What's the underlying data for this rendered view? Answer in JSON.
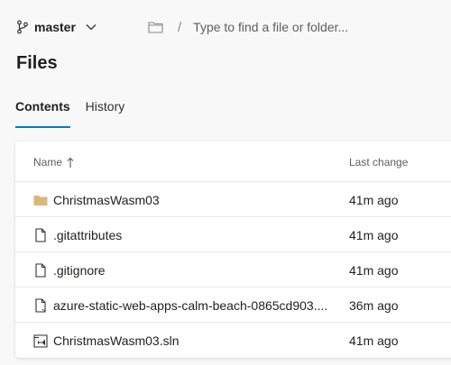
{
  "branch": {
    "name": "master",
    "icon": "branch-icon"
  },
  "path": {
    "separator": "/",
    "placeholder": "Type to find a file or folder..."
  },
  "page_title": "Files",
  "tabs": [
    {
      "label": "Contents",
      "active": true
    },
    {
      "label": "History",
      "active": false
    }
  ],
  "table": {
    "headers": {
      "name": "Name",
      "last_change": "Last change"
    },
    "rows": [
      {
        "icon": "folder-icon",
        "name": "ChristmasWasm03",
        "last_change": "41m ago"
      },
      {
        "icon": "file-icon",
        "name": ".gitattributes",
        "last_change": "41m ago"
      },
      {
        "icon": "file-icon",
        "name": ".gitignore",
        "last_change": "41m ago"
      },
      {
        "icon": "yaml-file-icon",
        "name": "azure-static-web-apps-calm-beach-0865cd903....",
        "last_change": "36m ago"
      },
      {
        "icon": "visual-studio-solution-icon",
        "name": "ChristmasWasm03.sln",
        "last_change": "41m ago"
      }
    ]
  },
  "colors": {
    "accent": "#0078d4",
    "folder": "#dcb67a",
    "text": "#201f1e",
    "muted": "#605e5c"
  }
}
